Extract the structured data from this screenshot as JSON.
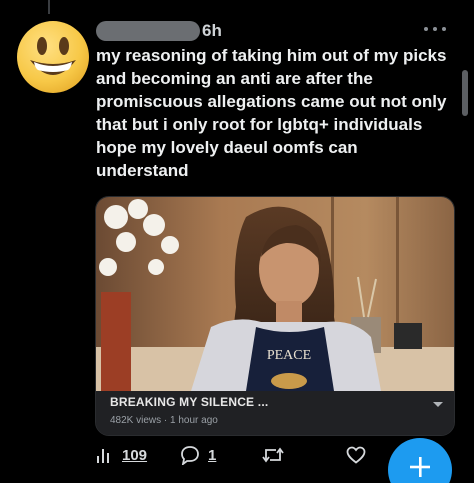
{
  "tweet": {
    "time": "6h",
    "text": "my reasoning of taking him out of my picks and becoming an anti are after the promiscuous allegations came out not only that but i only root for lgbtq+ individuals hope my lovely daeul oomfs can understand"
  },
  "video_card": {
    "title": "BREAKING MY SILENCE ...",
    "subtitle": "482K views · 1 hour ago",
    "shirt_text": "PEACE"
  },
  "actions": {
    "views_count": "109",
    "reply_count": "1"
  },
  "colors": {
    "accent": "#1d9bf0",
    "emoji_yellow": "#f7c847"
  }
}
